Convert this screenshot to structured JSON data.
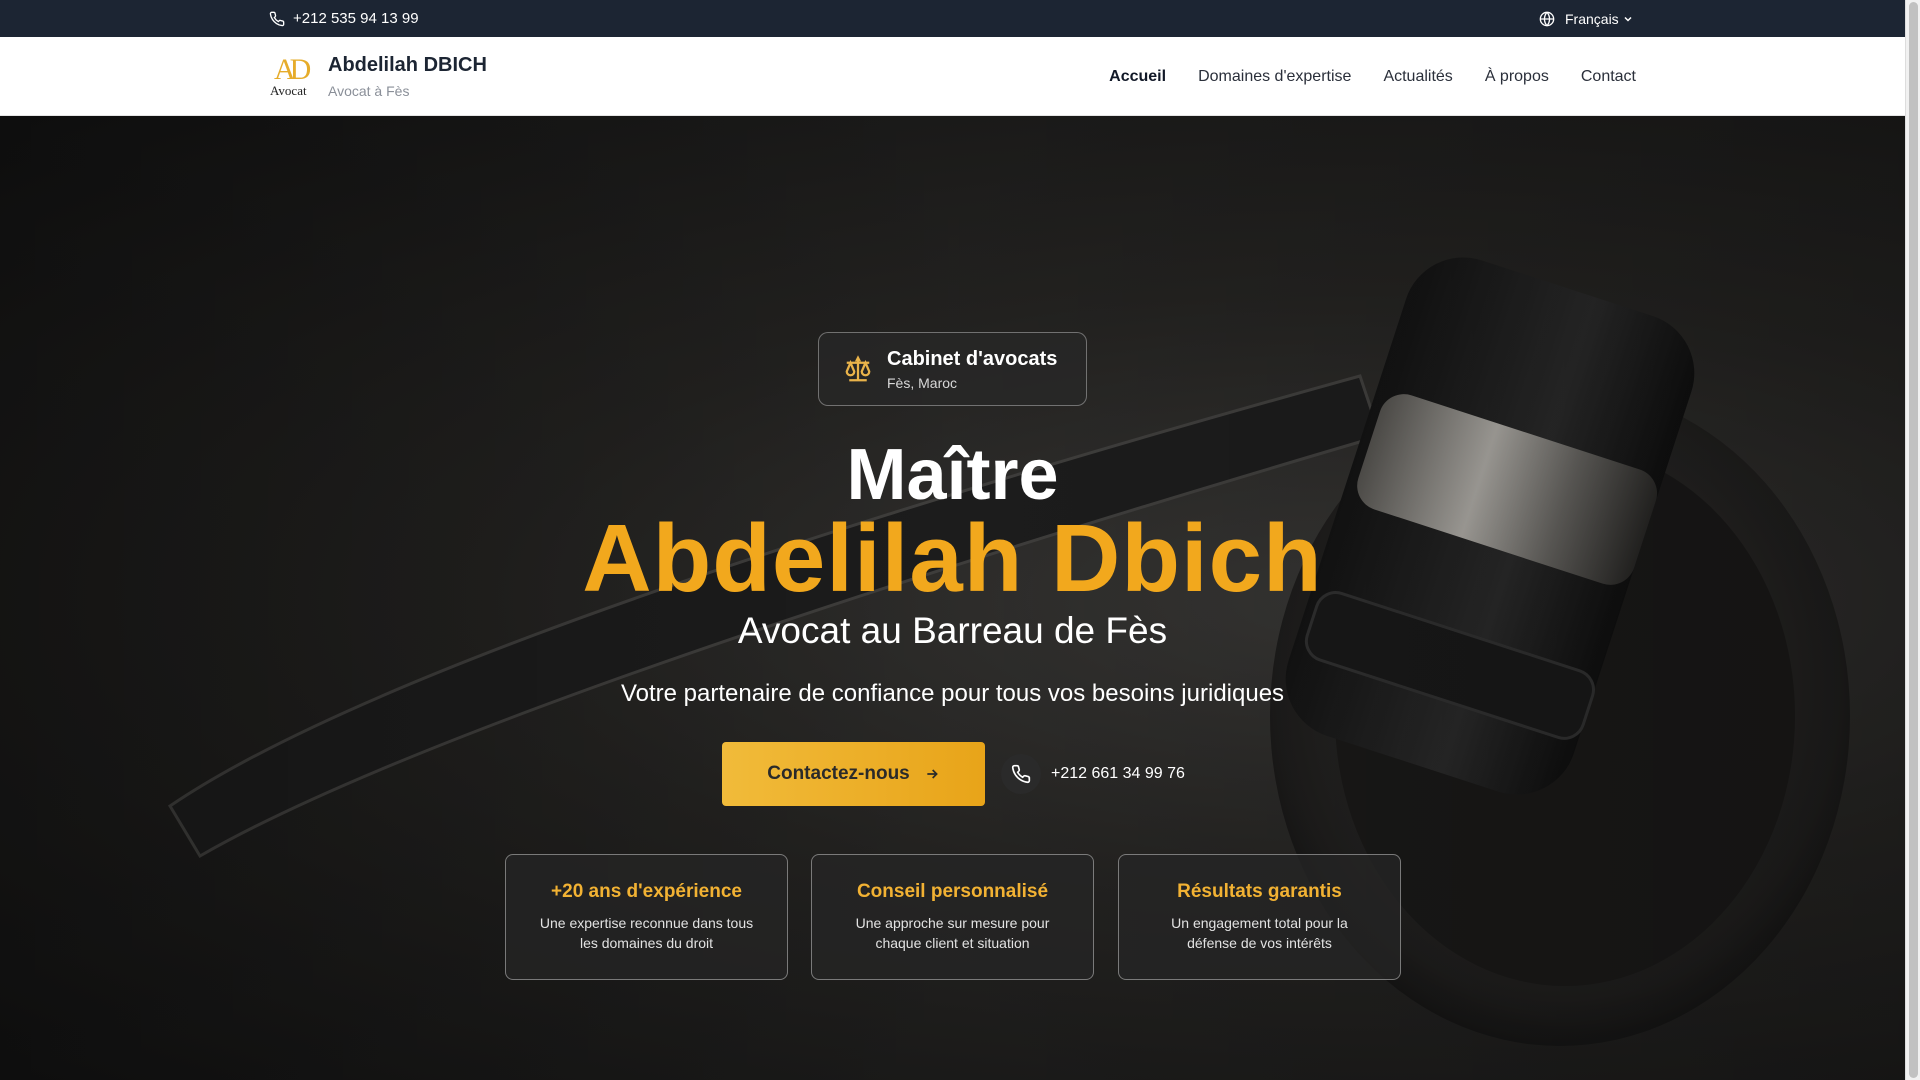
{
  "topbar": {
    "phone": "+212 535 94 13 99",
    "language": "Français"
  },
  "brand": {
    "logo_mono": "AD",
    "logo_word": "Avocat",
    "name": "Abdelilah DBICH",
    "tagline": "Avocat à Fès"
  },
  "nav": [
    {
      "label": "Accueil",
      "active": true
    },
    {
      "label": "Domaines d'expertise"
    },
    {
      "label": "Actualités"
    },
    {
      "label": "À propos"
    },
    {
      "label": "Contact"
    }
  ],
  "hero": {
    "badge_title": "Cabinet d'avocats",
    "badge_sub": "Fès, Maroc",
    "title_line1": "Maître",
    "title_line2": "Abdelilah Dbich",
    "subtitle": "Avocat au Barreau de Fès",
    "tagline": "Votre partenaire de confiance pour tous vos besoins juridiques",
    "cta_label": "Contactez-nous",
    "call_number": "+212 661 34 99 76"
  },
  "features": [
    {
      "title": "+20 ans d'expérience",
      "desc": "Une expertise reconnue dans tous les domaines du droit"
    },
    {
      "title": "Conseil personnalisé",
      "desc": "Une approche sur mesure pour chaque client et situation"
    },
    {
      "title": "Résultats garantis",
      "desc": "Un engagement total pour la défense de vos intérêts"
    }
  ],
  "colors": {
    "accent": "#f2a81d",
    "topbar": "#1c2533"
  },
  "icons": [
    "phone-icon",
    "globe-icon",
    "chevron-down-icon",
    "scales-icon",
    "arrow-right-icon"
  ]
}
